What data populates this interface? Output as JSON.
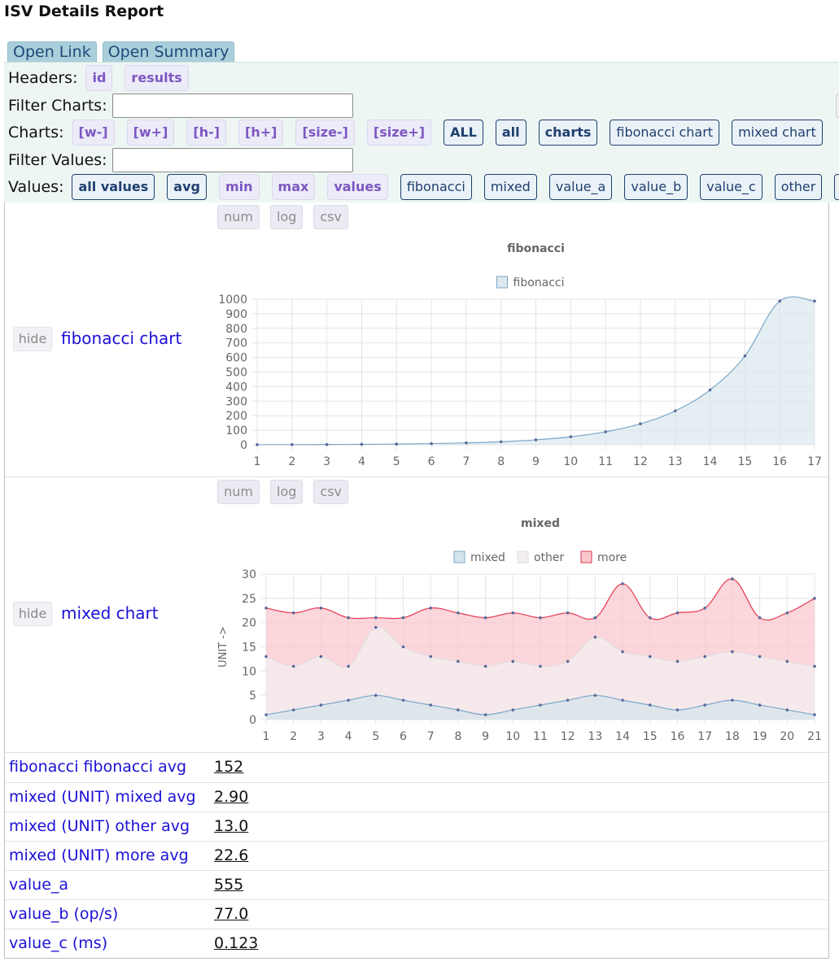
{
  "page": {
    "title": "ISV Details Report"
  },
  "top_buttons": {
    "open_link": "Open Link",
    "open_summary": "Open Summary"
  },
  "controls": {
    "headers": {
      "label": "Headers:",
      "chips": [
        "id",
        "results"
      ]
    },
    "filter_charts": {
      "label": "Filter Charts:",
      "value": ""
    },
    "charts": {
      "label": "Charts:",
      "size_chips": [
        "[w-]",
        "[w+]",
        "[h-]",
        "[h+]",
        "[size-]",
        "[size+]"
      ],
      "bold_chips": [
        "ALL",
        "all",
        "charts"
      ],
      "plain_chips": [
        "fibonacci chart",
        "mixed chart"
      ]
    },
    "filter_values": {
      "label": "Filter Values:",
      "value": ""
    },
    "values": {
      "label": "Values:",
      "bold_chips": [
        "all values",
        "avg"
      ],
      "purple_chips": [
        "min",
        "max",
        "values"
      ],
      "plain_chips": [
        "fibonacci",
        "mixed",
        "value_a",
        "value_b",
        "value_c",
        "other",
        "m"
      ]
    }
  },
  "charts": [
    {
      "hide_label": "hide",
      "link_label": "fibonacci chart",
      "buttons": [
        "num",
        "log",
        "csv"
      ]
    },
    {
      "hide_label": "hide",
      "link_label": "mixed chart",
      "buttons": [
        "num",
        "log",
        "csv"
      ]
    }
  ],
  "chart_data": [
    {
      "type": "area",
      "title": "fibonacci",
      "xlabel": "",
      "ylabel": "",
      "x": [
        1,
        2,
        3,
        4,
        5,
        6,
        7,
        8,
        9,
        10,
        11,
        12,
        13,
        14,
        15,
        16,
        17
      ],
      "ylim": [
        0,
        1000
      ],
      "yticks": [
        0,
        100,
        200,
        300,
        400,
        500,
        600,
        700,
        800,
        900,
        1000
      ],
      "grid": true,
      "legend_position": "top",
      "series": [
        {
          "name": "fibonacci",
          "color": "#7ba7c9",
          "fill": "#dce8ee",
          "values": [
            1,
            1,
            2,
            3,
            5,
            8,
            13,
            21,
            34,
            55,
            89,
            144,
            233,
            377,
            610,
            987,
            987
          ]
        }
      ]
    },
    {
      "type": "area",
      "title": "mixed",
      "xlabel": "",
      "ylabel": "UNIT ->",
      "x": [
        1,
        2,
        3,
        4,
        5,
        6,
        7,
        8,
        9,
        10,
        11,
        12,
        13,
        14,
        15,
        16,
        17,
        18,
        19,
        20,
        21
      ],
      "ylim": [
        0,
        30
      ],
      "yticks": [
        0,
        5,
        10,
        15,
        20,
        25,
        30
      ],
      "grid": true,
      "legend_position": "top",
      "series": [
        {
          "name": "mixed",
          "color": "#7ba7c9",
          "fill": "#d6e4ec",
          "values": [
            1,
            2,
            3,
            4,
            5,
            4,
            3,
            2,
            1,
            2,
            3,
            4,
            5,
            4,
            3,
            2,
            3,
            4,
            3,
            2,
            1
          ]
        },
        {
          "name": "other",
          "color": "#e2dde0",
          "fill": "#f3eff0",
          "values": [
            13,
            11,
            13,
            11,
            19,
            15,
            13,
            12,
            11,
            12,
            11,
            12,
            17,
            14,
            13,
            12,
            13,
            14,
            13,
            12,
            11
          ]
        },
        {
          "name": "more",
          "color": "#e53950",
          "fill": "#f9c8cf",
          "values": [
            23,
            22,
            23,
            21,
            21,
            21,
            23,
            22,
            21,
            22,
            21,
            22,
            21,
            28,
            21,
            22,
            23,
            29,
            21,
            22,
            25
          ]
        }
      ]
    }
  ],
  "values_table": [
    {
      "name": "fibonacci fibonacci avg",
      "value": "152"
    },
    {
      "name": "mixed (UNIT) mixed avg",
      "value": "2.90"
    },
    {
      "name": "mixed (UNIT) other avg",
      "value": "13.0"
    },
    {
      "name": "mixed (UNIT) more avg",
      "value": "22.6"
    },
    {
      "name": "value_a",
      "value": "555"
    },
    {
      "name": "value_b (op/s)",
      "value": "77.0"
    },
    {
      "name": "value_c (ms)",
      "value": "0.123"
    }
  ]
}
